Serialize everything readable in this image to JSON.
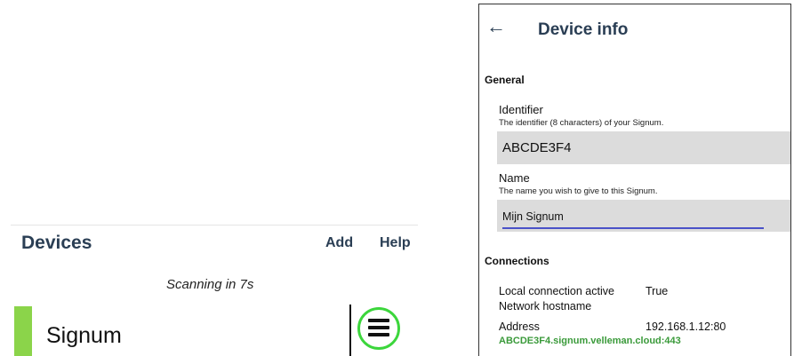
{
  "devices_screen": {
    "title": "Devices",
    "add_label": "Add",
    "help_label": "Help",
    "scan_status": "Scanning in 7s",
    "device": {
      "name": "Signum",
      "status_color": "#8bd44a"
    }
  },
  "device_info": {
    "title": "Device info",
    "general": {
      "heading": "General",
      "identifier_label": "Identifier",
      "identifier_desc": "The identifier (8 characters) of your Signum.",
      "identifier_value": "ABCDE3F4",
      "name_label": "Name",
      "name_desc": "The name you wish to give to this Signum.",
      "name_value": "Mijn Signum"
    },
    "connections": {
      "heading": "Connections",
      "local_label": "Local connection active",
      "local_value": "True",
      "hostname_label": "Network hostname",
      "address_label": "Address",
      "address_value": "192.168.1.12:80",
      "cloud_url": "ABCDE3F4.signum.velleman.cloud:443"
    }
  },
  "colors": {
    "accent_green": "#3cd63c",
    "link_green": "#3a9a3a",
    "title_navy": "#2a3e54",
    "input_underline": "#4a52c8"
  }
}
